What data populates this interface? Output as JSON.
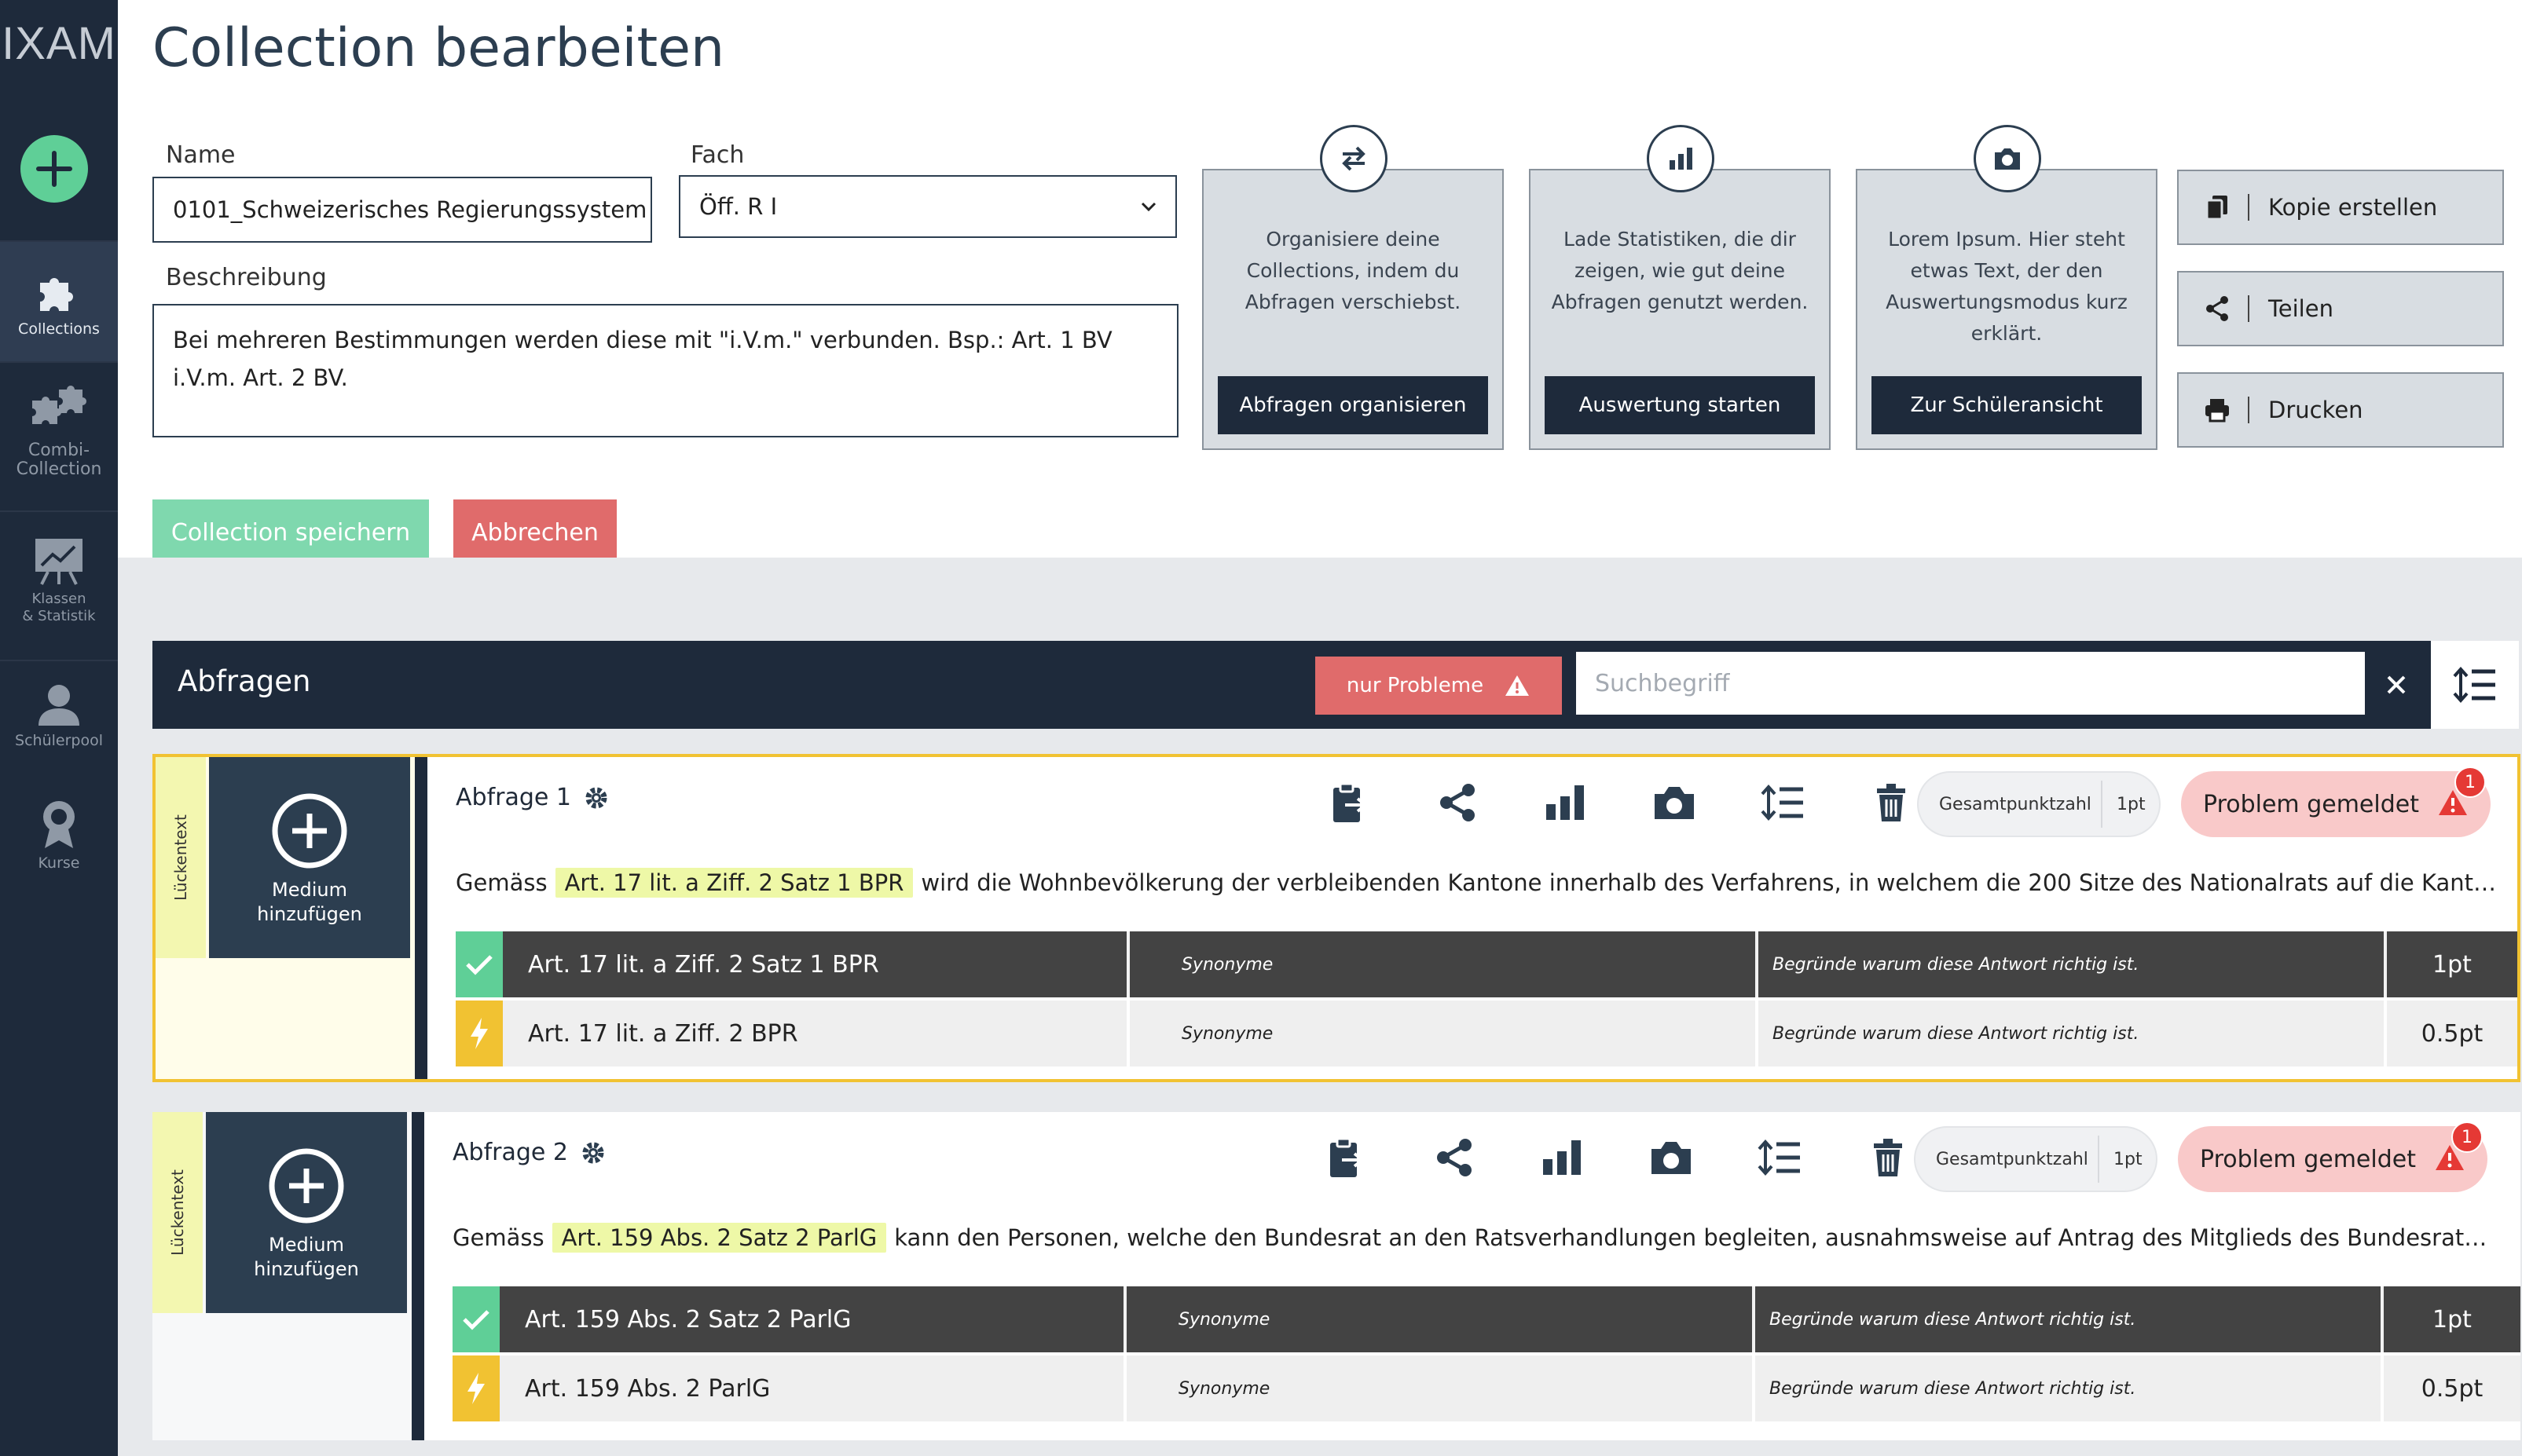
{
  "app": {
    "logo": "IXAM"
  },
  "colors": {
    "sidebar": "#1e2a3b",
    "accent_green": "#5fcf97",
    "danger": "#e06b6b",
    "highlight": "#eef8a7",
    "selected_border": "#f1c232"
  },
  "sidebar": {
    "add_icon": "plus-circle-icon",
    "items": [
      {
        "label": "Collections",
        "icon": "puzzle-icon",
        "active": true
      },
      {
        "label": "Combi-\nCollection",
        "icon": "puzzle-pieces-icon",
        "active": false
      },
      {
        "label": "Klassen\n& Statistik",
        "icon": "chart-board-icon",
        "active": false
      },
      {
        "label": "Schülerpool",
        "icon": "users-icon",
        "active": false
      },
      {
        "label": "Kurse",
        "icon": "award-icon",
        "active": false
      }
    ]
  },
  "page": {
    "title": "Collection bearbeiten"
  },
  "form": {
    "name_label": "Name",
    "name_value": "0101_Schweizerisches Regierungssystem",
    "fach_label": "Fach",
    "fach_value": "Öff. R I",
    "beschreibung_label": "Beschreibung",
    "beschreibung_value": "Bei mehreren Bestimmungen werden diese mit \"i.V.m.\" verbunden. Bsp.: Art. 1 BV i.V.m. Art. 2 BV.",
    "save_label": "Collection speichern",
    "cancel_label": "Abbrechen"
  },
  "cards": [
    {
      "icon": "swap-arrows-icon",
      "text": "Organisiere deine Collections, indem du Abfragen verschiebst.",
      "button": "Abfragen organisieren"
    },
    {
      "icon": "bar-chart-icon",
      "text": "Lade Statistiken, die dir zeigen, wie gut deine Abfragen genutzt werden.",
      "button": "Auswertung starten"
    },
    {
      "icon": "camera-icon",
      "text": "Lorem Ipsum. Hier steht etwas Text, der den Auswertungsmodus kurz erklärt.",
      "button": "Zur Schüleransicht"
    }
  ],
  "actions": [
    {
      "icon": "copy-icon",
      "label": "Kopie erstellen"
    },
    {
      "icon": "share-icon",
      "label": "Teilen"
    },
    {
      "icon": "print-icon",
      "label": "Drucken"
    }
  ],
  "abfragen": {
    "title": "Abfragen",
    "filter_label": "nur Probleme",
    "search_placeholder": "Suchbegriff",
    "items": [
      {
        "type": "Lückentext",
        "medium_label": "Medium\nhinzufügen",
        "title": "Abfrage 1",
        "points_label": "Gesamtpunktzahl",
        "points_value": "1pt",
        "problem_label": "Problem gemeldet",
        "problem_count": "1",
        "text_before": "Gemäss",
        "text_highlight": "Art. 17 lit. a Ziff. 2 Satz 1 BPR",
        "text_after": "wird die Wohnbevölkerung der verbleibenden Kantone innerhalb des Verfahrens, in welchem die 200 Sitze des Nationalrats auf die Kantone verteilt werden, durch die noch verbleibenden Sitze geteilt.",
        "answers": [
          {
            "kind": "correct",
            "answer": "Art. 17 lit. a Ziff. 2 Satz 1 BPR",
            "synonyme": "Synonyme",
            "begruendung": "Begründe warum diese Antwort richtig ist.",
            "points": "1pt"
          },
          {
            "kind": "partial",
            "answer": "Art. 17 lit. a Ziff. 2 BPR",
            "synonyme": "Synonyme",
            "begruendung": "Begründe warum diese Antwort richtig ist.",
            "points": "0.5pt"
          }
        ]
      },
      {
        "type": "Lückentext",
        "medium_label": "Medium\nhinzufügen",
        "title": "Abfrage 2",
        "points_label": "Gesamtpunktzahl",
        "points_value": "1pt",
        "problem_label": "Problem gemeldet",
        "problem_count": "1",
        "text_before": "Gemäss",
        "text_highlight": "Art. 159 Abs. 2 Satz 2 ParlG",
        "text_after": "kann den Personen, welche den Bundesrat an den Ratsverhandlungen begleiten, ausnahmsweise auf Antrag des Mitglieds des Bundesrates das Wort erteilt werden.",
        "answers": [
          {
            "kind": "correct",
            "answer": "Art. 159 Abs. 2 Satz 2 ParlG",
            "synonyme": "Synonyme",
            "begruendung": "Begründe warum diese Antwort richtig ist.",
            "points": "1pt"
          },
          {
            "kind": "partial",
            "answer": "Art. 159 Abs. 2 ParlG",
            "synonyme": "Synonyme",
            "begruendung": "Begründe warum diese Antwort richtig ist.",
            "points": "0.5pt"
          }
        ]
      }
    ]
  }
}
